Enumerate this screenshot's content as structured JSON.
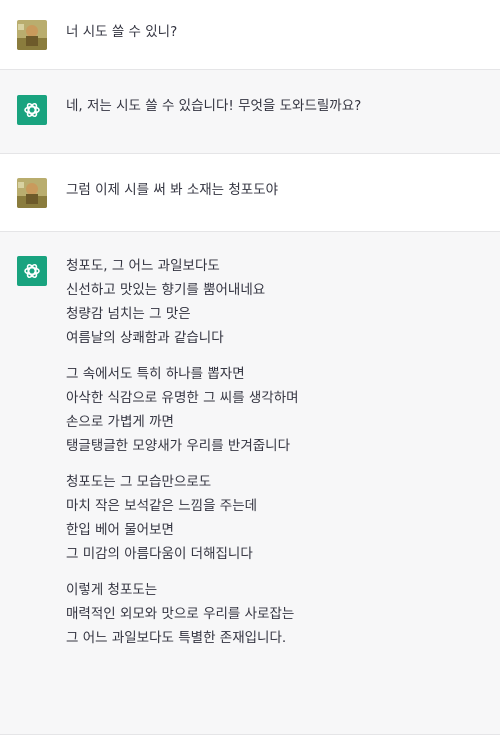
{
  "conversation": {
    "messages": [
      {
        "role": "user",
        "text": "너 시도 쓸 수 있니?"
      },
      {
        "role": "assistant",
        "text": "네, 저는 시도 쓸 수 있습니다! 무엇을 도와드릴까요?"
      },
      {
        "role": "user",
        "text": "그럼 이제 시를 써 봐 소재는 청포도야"
      }
    ],
    "poem": {
      "stanzas": [
        [
          "청포도, 그 어느 과일보다도",
          "신선하고 맛있는 향기를 뿜어내네요",
          "청량감 넘치는 그 맛은",
          "여름날의 상쾌함과 같습니다"
        ],
        [
          "그 속에서도 특히 하나를 뽑자면",
          "아삭한 식감으로 유명한 그 씨를 생각하며",
          "손으로 가볍게 까면",
          "탱글탱글한 모양새가 우리를 반겨줍니다"
        ],
        [
          "청포도는 그 모습만으로도",
          "마치 작은 보석같은 느낌을 주는데",
          "한입 베어 물어보면",
          "그 미감의 아름다움이 더해집니다"
        ],
        [
          "이렇게 청포도는",
          "매력적인 외모와 맛으로 우리를 사로잡는",
          "그 어느 과일보다도 특별한 존재입니다."
        ]
      ]
    }
  },
  "colors": {
    "assistant_avatar_bg": "#19a37f",
    "assistant_row_bg": "#f7f7f8",
    "user_row_bg": "#ffffff",
    "text": "#343541"
  },
  "icons": {
    "user_avatar": "user-photo-avatar",
    "assistant_avatar": "chatgpt-logo-icon"
  }
}
